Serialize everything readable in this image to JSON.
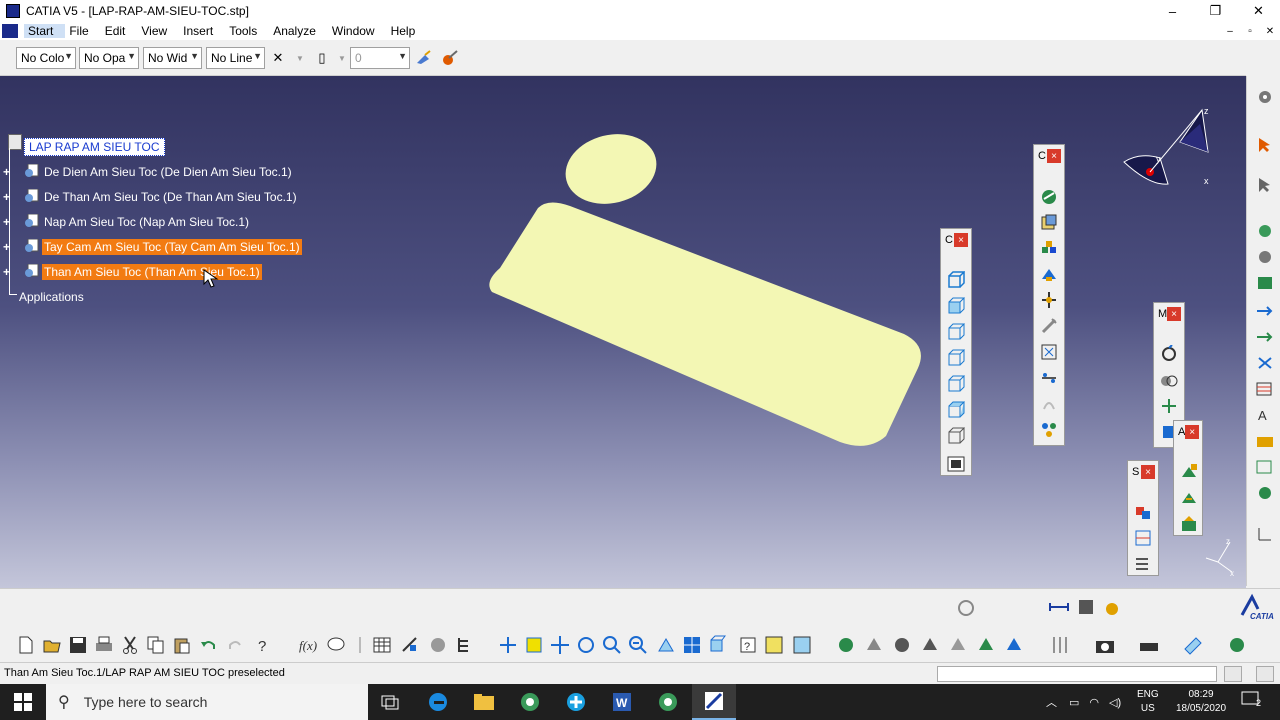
{
  "window": {
    "title": "CATIA V5 - [LAP-RAP-AM-SIEU-TOC.stp]",
    "controls": [
      "–",
      "❐",
      "✕"
    ]
  },
  "menu": {
    "items": [
      "Start",
      "File",
      "Edit",
      "View",
      "Insert",
      "Tools",
      "Analyze",
      "Window",
      "Help"
    ],
    "mdi_controls": [
      "–",
      "▫",
      "✕"
    ]
  },
  "properties_toolbar": {
    "color": "No Colo",
    "opacity": "No Opa",
    "line_width": "No Wid",
    "line_type": "No Line",
    "layer_value": "0"
  },
  "spec_tree": {
    "root": "LAP RAP AM SIEU TOC",
    "items": [
      {
        "label": "De Dien Am Sieu Toc (De Dien Am Sieu Toc.1)",
        "selected": false
      },
      {
        "label": "De Than Am Sieu Toc (De Than Am Sieu Toc.1)",
        "selected": false
      },
      {
        "label": "Nap Am Sieu Toc (Nap Am Sieu Toc.1)",
        "selected": false
      },
      {
        "label": "Tay Cam Am Sieu Toc (Tay Cam Am Sieu Toc.1)",
        "selected": true
      },
      {
        "label": "Than Am Sieu Toc (Than Am Sieu Toc.1)",
        "selected": true
      }
    ],
    "applications": "Applications"
  },
  "floating_toolbars": {
    "views": {
      "title": "C"
    },
    "product": {
      "title": "C"
    },
    "move": {
      "title": "M"
    },
    "assembly": {
      "title": "A"
    },
    "space": {
      "title": "S"
    }
  },
  "status": {
    "text": "Than Am Sieu Toc.1/LAP RAP AM SIEU TOC preselected"
  },
  "taskbar": {
    "search_placeholder": "Type here to search",
    "lang_line1": "ENG",
    "lang_line2": "US",
    "time": "08:29",
    "date": "18/05/2020",
    "notifications": "2"
  },
  "colors": {
    "selection": "#f27b12",
    "part": "#f3f7b4",
    "viewport_top": "#323360",
    "viewport_bottom": "#c4c6da"
  }
}
